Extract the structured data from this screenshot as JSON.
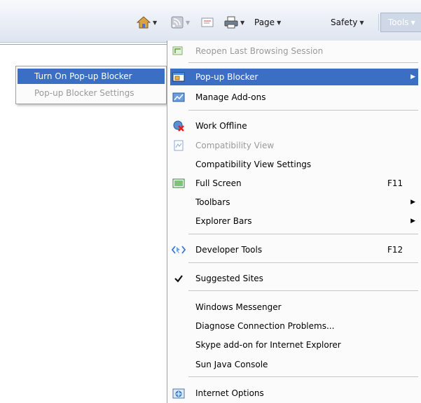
{
  "toolbar": {
    "page_label": "Page",
    "safety_label": "Safety",
    "tools_label": "Tools"
  },
  "submenu": {
    "items": [
      {
        "label": "Turn On Pop-up Blocker"
      },
      {
        "label": "Pop-up Blocker Settings"
      }
    ]
  },
  "menu": {
    "items": [
      {
        "label": "Reopen Last Browsing Session"
      },
      {
        "label": "Pop-up Blocker"
      },
      {
        "label": "Manage Add-ons"
      },
      {
        "label": "Work Offline"
      },
      {
        "label": "Compatibility View"
      },
      {
        "label": "Compatibility View Settings"
      },
      {
        "label": "Full Screen",
        "shortcut": "F11"
      },
      {
        "label": "Toolbars"
      },
      {
        "label": "Explorer Bars"
      },
      {
        "label": "Developer Tools",
        "shortcut": "F12"
      },
      {
        "label": "Suggested Sites"
      },
      {
        "label": "Windows Messenger"
      },
      {
        "label": "Diagnose Connection Problems..."
      },
      {
        "label": "Skype add-on for Internet Explorer"
      },
      {
        "label": "Sun Java Console"
      },
      {
        "label": "Internet Options"
      }
    ]
  },
  "colors": {
    "highlight": "#3b6fc4",
    "disabled_text": "#9a9a9a"
  }
}
